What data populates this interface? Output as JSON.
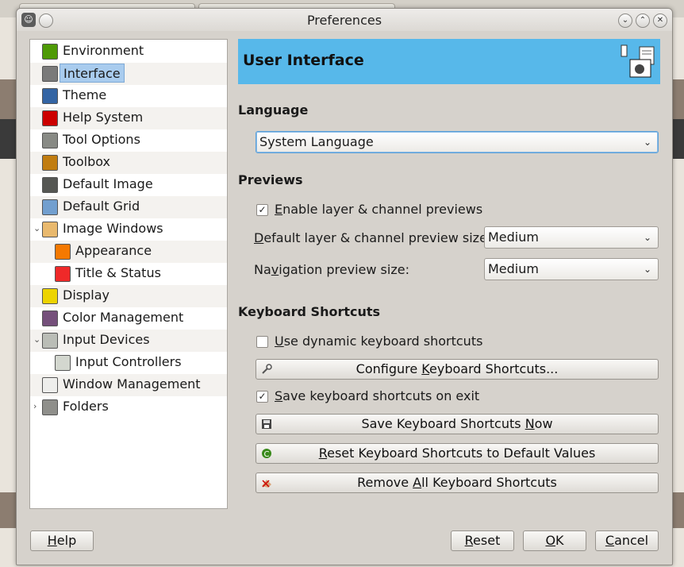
{
  "window": {
    "title": "Preferences",
    "controls": [
      "minimize",
      "maximize",
      "close"
    ]
  },
  "tree": {
    "items": [
      {
        "label": "Environment",
        "indent": 0,
        "expander": "",
        "icon": "environment-icon",
        "color": "#4e9a06"
      },
      {
        "label": "Interface",
        "indent": 0,
        "expander": "",
        "icon": "interface-icon",
        "color": "#7a7a7a",
        "selected": true
      },
      {
        "label": "Theme",
        "indent": 0,
        "expander": "",
        "icon": "theme-icon",
        "color": "#3465a4"
      },
      {
        "label": "Help System",
        "indent": 0,
        "expander": "",
        "icon": "help-system-icon",
        "color": "#cc0000"
      },
      {
        "label": "Tool Options",
        "indent": 0,
        "expander": "",
        "icon": "tool-options-icon",
        "color": "#888a85"
      },
      {
        "label": "Toolbox",
        "indent": 0,
        "expander": "",
        "icon": "toolbox-icon",
        "color": "#c17d11"
      },
      {
        "label": "Default Image",
        "indent": 0,
        "expander": "",
        "icon": "default-image-icon",
        "color": "#555753"
      },
      {
        "label": "Default Grid",
        "indent": 0,
        "expander": "",
        "icon": "default-grid-icon",
        "color": "#729fcf"
      },
      {
        "label": "Image Windows",
        "indent": 0,
        "expander": "⌄",
        "icon": "image-windows-icon",
        "color": "#e9b96e"
      },
      {
        "label": "Appearance",
        "indent": 1,
        "expander": "",
        "icon": "appearance-icon",
        "color": "#f57900"
      },
      {
        "label": "Title & Status",
        "indent": 1,
        "expander": "",
        "icon": "title-status-icon",
        "color": "#ef2929"
      },
      {
        "label": "Display",
        "indent": 0,
        "expander": "",
        "icon": "display-icon",
        "color": "#edd400"
      },
      {
        "label": "Color Management",
        "indent": 0,
        "expander": "",
        "icon": "color-management-icon",
        "color": "#75507b"
      },
      {
        "label": "Input Devices",
        "indent": 0,
        "expander": "⌄",
        "icon": "input-devices-icon",
        "color": "#babdb6"
      },
      {
        "label": "Input Controllers",
        "indent": 1,
        "expander": "",
        "icon": "input-controllers-icon",
        "color": "#d3d7cf"
      },
      {
        "label": "Window Management",
        "indent": 0,
        "expander": "",
        "icon": "window-management-icon",
        "color": "#eeeeec"
      },
      {
        "label": "Folders",
        "indent": 0,
        "expander": "›",
        "icon": "folders-icon",
        "color": "#8f8f8b"
      }
    ]
  },
  "panel": {
    "header_title": "User Interface",
    "language": {
      "section": "Language",
      "value": "System Language"
    },
    "previews": {
      "section": "Previews",
      "enable_label_pre": "",
      "enable_label_u": "E",
      "enable_label_post": "nable layer & channel previews",
      "enable_checked": true,
      "layer_size_label_pre": "",
      "layer_size_label_u": "D",
      "layer_size_label_post": "efault layer & channel preview size:",
      "layer_size_value": "Medium",
      "nav_size_label_pre": "Na",
      "nav_size_label_u": "v",
      "nav_size_label_post": "igation preview size:",
      "nav_size_value": "Medium"
    },
    "shortcuts": {
      "section": "Keyboard Shortcuts",
      "dynamic_pre": "",
      "dynamic_u": "U",
      "dynamic_post": "se dynamic keyboard shortcuts",
      "dynamic_checked": false,
      "configure_pre": "Configure ",
      "configure_u": "K",
      "configure_post": "eyboard Shortcuts...",
      "save_exit_pre": "",
      "save_exit_u": "S",
      "save_exit_post": "ave keyboard shortcuts on exit",
      "save_exit_checked": true,
      "save_now_pre": "Save Keyboard Shortcuts ",
      "save_now_u": "N",
      "save_now_post": "ow",
      "reset_pre": "",
      "reset_u": "R",
      "reset_post": "eset Keyboard Shortcuts to Default Values",
      "remove_pre": "Remove ",
      "remove_u": "A",
      "remove_post": "ll Keyboard Shortcuts"
    }
  },
  "footer": {
    "help_u": "H",
    "help_post": "elp",
    "reset_u": "R",
    "reset_post": "eset",
    "ok_u": "O",
    "ok_post": "K",
    "cancel_u": "C",
    "cancel_post": "ancel"
  },
  "colors": {
    "header_bg": "#57b8ea",
    "selection": "#a9ccee",
    "dialog_bg": "#d6d2cc"
  }
}
